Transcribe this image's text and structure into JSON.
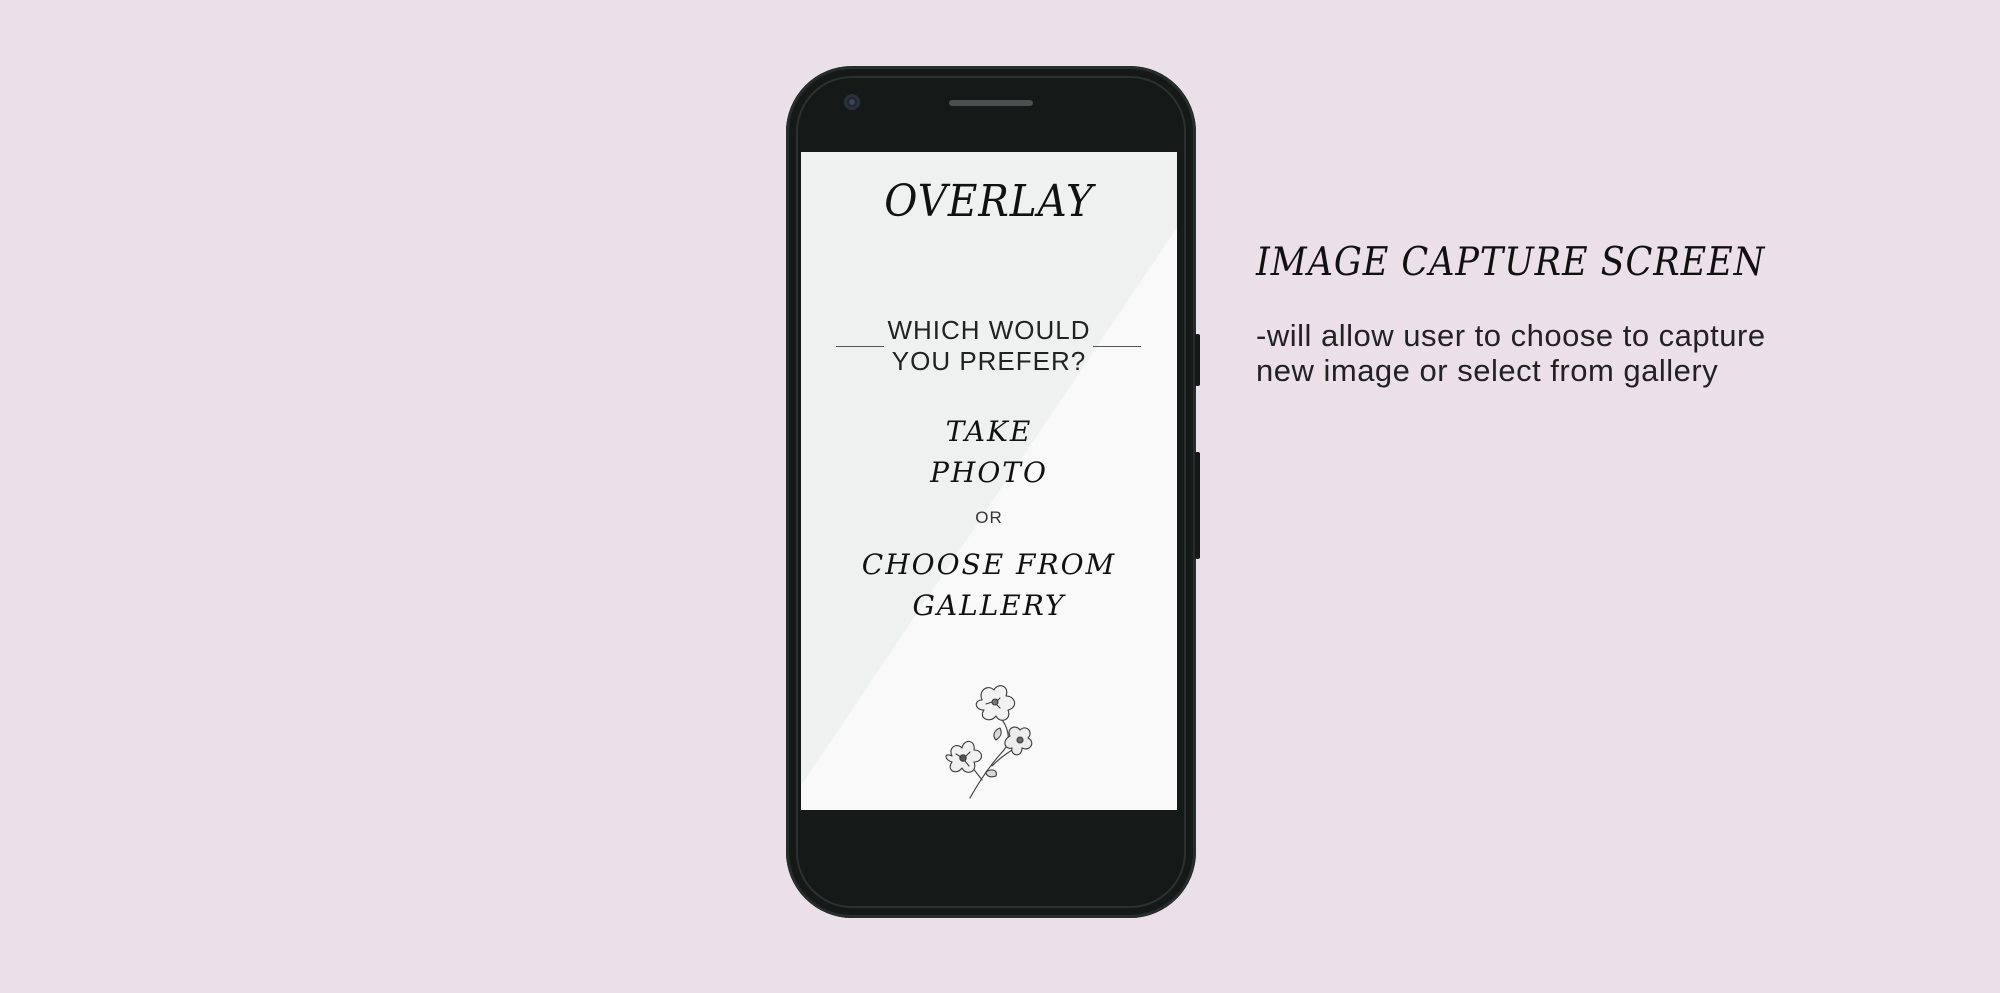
{
  "app": {
    "title": "OVERLAY",
    "prompt_line1": "WHICH WOULD",
    "prompt_line2": "YOU PREFER?",
    "take_photo_line1": "TAKE",
    "take_photo_line2": "PHOTO",
    "or_label": "OR",
    "gallery_line1": "CHOOSE FROM",
    "gallery_line2": "GALLERY",
    "decoration_icon": "flower-sketch-icon"
  },
  "annotation": {
    "title": "IMAGE CAPTURE SCREEN",
    "description_line1": "-will allow user to choose to capture",
    "description_line2": "new image or select from gallery"
  },
  "colors": {
    "background": "#ebe0e8",
    "phone_body": "#151918",
    "screen": "#eff1f0",
    "text": "#111111"
  }
}
